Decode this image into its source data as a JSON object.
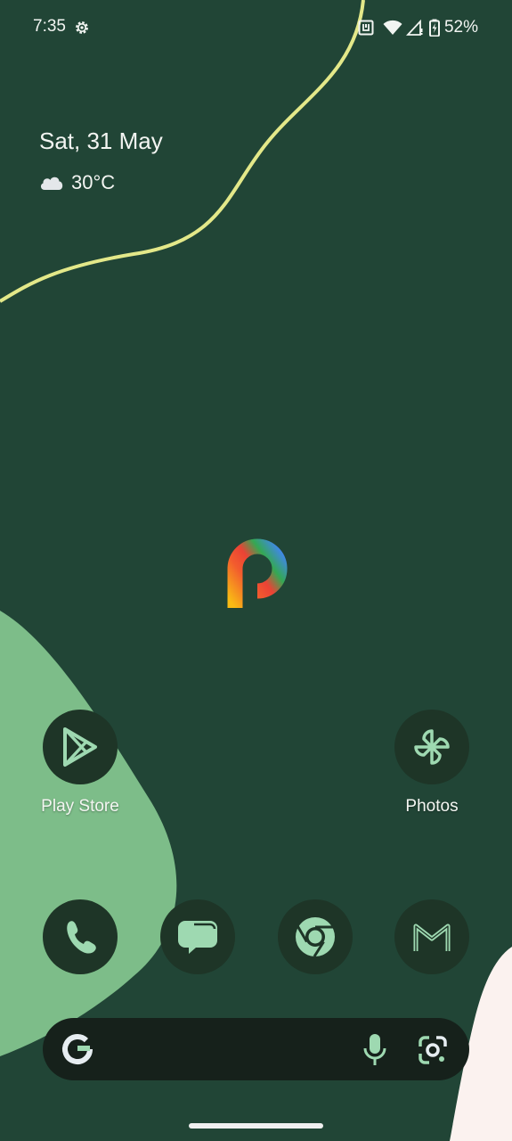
{
  "status_bar": {
    "time": "7:35",
    "battery_percent": "52%",
    "icons": [
      "gear-icon",
      "nfc-icon",
      "wifi-icon",
      "signal-icon",
      "battery-charging-icon"
    ]
  },
  "at_a_glance": {
    "date": "Sat, 31 May",
    "temperature": "30°C",
    "weather_icon": "cloud-icon"
  },
  "home_apps": [
    {
      "label": "Play Store",
      "icon": "play-store-icon"
    },
    {
      "label": "Photos",
      "icon": "pinwheel-icon"
    }
  ],
  "dock": [
    {
      "name": "phone",
      "icon": "phone-icon"
    },
    {
      "name": "messages",
      "icon": "chat-bubble-icon"
    },
    {
      "name": "chrome",
      "icon": "chrome-icon"
    },
    {
      "name": "gmail",
      "icon": "gmail-icon"
    }
  ],
  "search_bar": {
    "icons": [
      "google-g-icon",
      "mic-icon",
      "lens-icon"
    ]
  },
  "colors": {
    "wallpaper": "#214536",
    "blob_green": "#7dbd89",
    "curve_yellow": "#e3e889",
    "icon_bg": "#1e3527",
    "icon_fg": "#9ed9b1"
  }
}
